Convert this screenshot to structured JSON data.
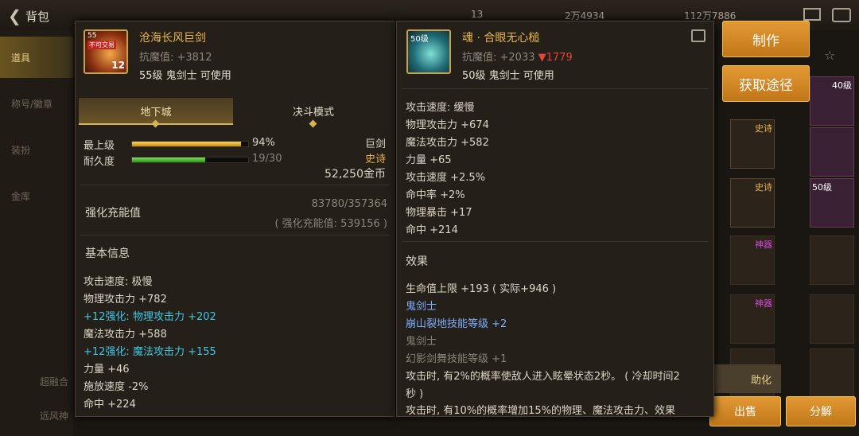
{
  "header": {
    "title": "背包",
    "currency1": "13",
    "currency2": "2万4934",
    "currency3": "112万7886"
  },
  "sidebar": {
    "items": [
      {
        "label": "道具"
      },
      {
        "label": "称号/徽章"
      },
      {
        "label": "装扮"
      },
      {
        "label": "金库"
      }
    ],
    "bottom": [
      {
        "label": "超融合"
      },
      {
        "label": "远风神"
      }
    ]
  },
  "right": {
    "make_label": "制作",
    "obtain_label": "获取途径",
    "bottom_btn1": "出售",
    "bottom_btn2": "分解",
    "slot_tags": [
      "史诗",
      "史诗",
      "神器",
      "神器"
    ],
    "slot_level": "40级",
    "slot_level2": "50级",
    "assist_label": "助化"
  },
  "item1": {
    "level_badge": "55",
    "lock_badge": "不可交易",
    "enhance_badge": "12",
    "name": "沧海长风巨剑",
    "resist": "抗魔值: +3812",
    "requirement": "55级 鬼剑士 可使用",
    "tabs": [
      "地下城",
      "决斗模式"
    ],
    "stats": {
      "top_label": "最上级",
      "top_value": "94%",
      "top_pct": 0.94,
      "dur_label": "耐久度",
      "dur_value": "19/30",
      "dur_pct": 0.633,
      "type": "巨剑",
      "rarity": "史诗",
      "price": "52,250金币"
    },
    "charge": {
      "label": "强化充能值",
      "value": "83780/357364",
      "sub": "( 强化充能值: 539156 )"
    },
    "basic_title": "基本信息",
    "lines": [
      "攻击速度: 极慢",
      "物理攻击力 +782",
      "+12强化: 物理攻击力 +202",
      "魔法攻击力 +588",
      "+12强化: 魔法攻击力 +155",
      "力量 +46",
      "施放速度 -2%",
      "命中 +224"
    ]
  },
  "item2": {
    "level_badge": "50级",
    "name": "魂 · 合眼无心槌",
    "resist": "抗魔值: +2033",
    "resist_diff": "▼1779",
    "requirement": "50级 鬼剑士 可使用",
    "lines": [
      "攻击速度: 缓慢",
      "物理攻击力 +674",
      "魔法攻击力 +582",
      "力量 +65",
      "攻击速度 +2.5%",
      "命中率 +2%",
      "物理暴击 +17",
      "命中 +214"
    ],
    "effect_title": "效果",
    "effects": [
      "生命值上限 +193 ( 实际+946 )",
      "鬼剑士",
      "崩山裂地技能等级 +2",
      "鬼剑士",
      "幻影剑舞技能等级 +1",
      "攻击时, 有2%的概率使敌人进入眩晕状态2秒。 ( 冷却时间2",
      "秒 )",
      "攻击时, 有10%的概率增加15%的物理、魔法攻击力、效果"
    ]
  }
}
